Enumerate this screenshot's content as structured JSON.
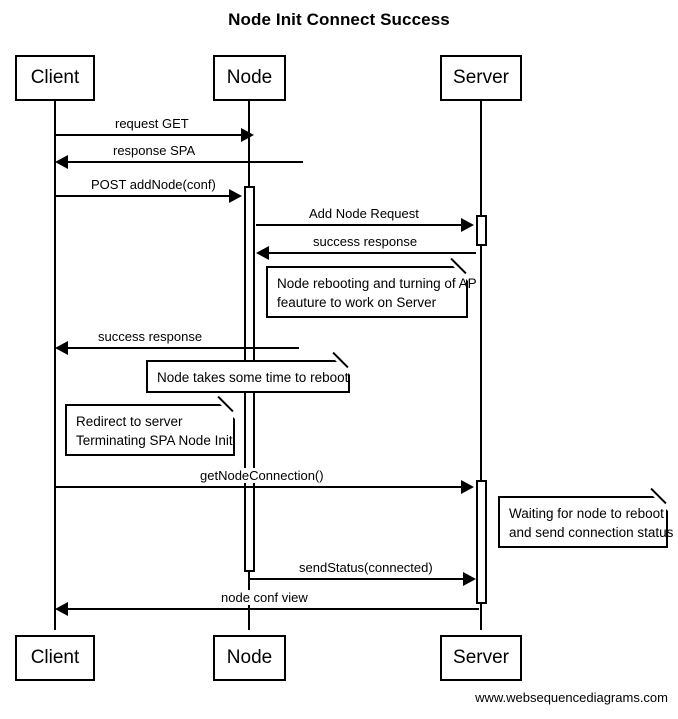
{
  "diagram": {
    "title": "Node Init Connect Success",
    "footer": "www.websequencediagrams.com",
    "participants": [
      {
        "id": "client",
        "label": "Client"
      },
      {
        "id": "node",
        "label": "Node"
      },
      {
        "id": "server",
        "label": "Server"
      }
    ],
    "messages": [
      {
        "id": "m1",
        "label": "request GET",
        "from": "client",
        "to": "node",
        "direction": "right"
      },
      {
        "id": "m2",
        "label": "response SPA",
        "from": "node",
        "to": "client",
        "direction": "left"
      },
      {
        "id": "m3",
        "label": "POST addNode(conf)",
        "from": "client",
        "to": "node",
        "direction": "right"
      },
      {
        "id": "m4",
        "label": "Add Node Request",
        "from": "node",
        "to": "server",
        "direction": "right"
      },
      {
        "id": "m5",
        "label": "success response",
        "from": "server",
        "to": "node",
        "direction": "left"
      },
      {
        "id": "m6",
        "label": "success response",
        "from": "node",
        "to": "client",
        "direction": "left"
      },
      {
        "id": "m7",
        "label": "getNodeConnection()",
        "from": "client",
        "to": "server",
        "direction": "right"
      },
      {
        "id": "m8",
        "label": "sendStatus(connected)",
        "from": "node",
        "to": "server",
        "direction": "right"
      },
      {
        "id": "m9",
        "label": "node conf view",
        "from": "server",
        "to": "client",
        "direction": "left"
      }
    ],
    "notes": [
      {
        "id": "n1",
        "over": "node",
        "lines": [
          "Node rebooting and turning of AP",
          "feauture to work on Server"
        ]
      },
      {
        "id": "n2",
        "over": "node",
        "lines": [
          "Node takes some time to reboot"
        ]
      },
      {
        "id": "n3",
        "over": "client",
        "lines": [
          "Redirect to server",
          "Terminating SPA Node Init"
        ]
      },
      {
        "id": "n4",
        "over": "server",
        "lines": [
          "Waiting for node to reboot",
          "and send connection status"
        ]
      }
    ],
    "colors": {
      "stroke": "#000000",
      "fill": "#ffffff",
      "text": "#000000"
    }
  }
}
